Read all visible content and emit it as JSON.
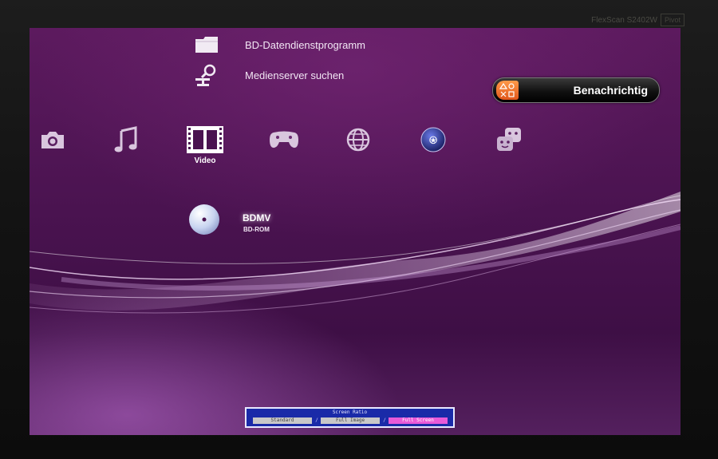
{
  "monitor": {
    "model": "FlexScan S2402W",
    "badge": "Pivot"
  },
  "menu_items": [
    {
      "label": "BD-Datendienstprogramm",
      "icon": "folder-icon"
    },
    {
      "label": "Medienserver suchen",
      "icon": "network-search-icon"
    }
  ],
  "notification": {
    "label": "Benachrichtig",
    "icon": "playstation-symbols-icon",
    "accent": "#e8661e"
  },
  "categories": [
    {
      "name": "photo",
      "icon": "camera-icon",
      "label": ""
    },
    {
      "name": "music",
      "icon": "music-note-icon",
      "label": ""
    },
    {
      "name": "video",
      "icon": "film-strip-icon",
      "label": "Video",
      "selected": true
    },
    {
      "name": "game",
      "icon": "gamepad-icon",
      "label": ""
    },
    {
      "name": "network",
      "icon": "globe-icon",
      "label": ""
    },
    {
      "name": "psn",
      "icon": "playstation-network-icon",
      "label": ""
    },
    {
      "name": "friends",
      "icon": "friends-icon",
      "label": ""
    }
  ],
  "selected_category_label": "Video",
  "disc": {
    "title": "BDMV",
    "subtitle": "BD-ROM",
    "icon": "bluray-disc-icon"
  },
  "screen_ratio_osd": {
    "title": "Screen Ratio",
    "options": [
      "Standard",
      "Full Image",
      "Full Screen"
    ],
    "selected": "Full Screen",
    "separator": "/"
  },
  "colors": {
    "background": "#4a1350",
    "wave": "#e9b8f2",
    "osd_bg": "#1a2aa8",
    "osd_selected": "#e85ad8"
  }
}
